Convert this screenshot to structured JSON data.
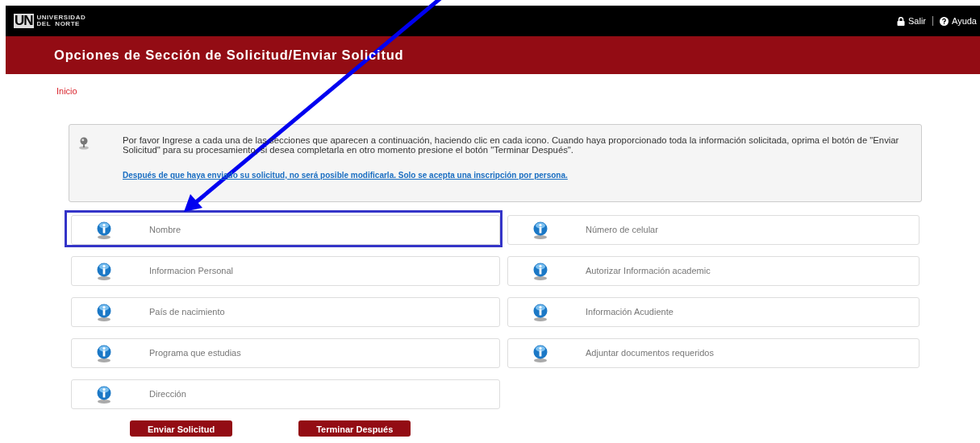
{
  "header": {
    "logo_mark": "UN",
    "logo_lines": [
      "UNIVERSIDAD",
      "DEL  NORTE"
    ],
    "links": [
      {
        "label": "Salir",
        "kind": "lock"
      },
      {
        "label": "Ayuda",
        "kind": "help"
      }
    ]
  },
  "title": "Opciones de Sección de Solicitud/Enviar Solicitud",
  "breadcrumb": "Inicio",
  "notice": {
    "text": "Por favor Ingrese a cada una de las secciones que aparecen a continuación, haciendo clic en cada icono. Cuando haya proporcionado toda la información solicitada, oprima el botón de \"Enviar Solicitud\" para su procesamiento, si desea completarla en otro momento presione el botón \"Terminar Después\".",
    "link": "Después de que haya enviado su solicitud, no será posible modificarla. Solo se acepta una inscripción por persona."
  },
  "sections": [
    [
      {
        "label": "Nombre",
        "highlighted": true
      },
      {
        "label": "Informacion Personal",
        "highlighted": false
      },
      {
        "label": "País de nacimiento",
        "highlighted": false
      },
      {
        "label": "Programa que estudias",
        "highlighted": false
      },
      {
        "label": "Dirección",
        "highlighted": false
      }
    ],
    [
      {
        "label": "Número de celular",
        "highlighted": false
      },
      {
        "label": "Autorizar Información academic",
        "highlighted": false
      },
      {
        "label": "Información Acudiente",
        "highlighted": false
      },
      {
        "label": "Adjuntar documentos requeridos",
        "highlighted": false
      }
    ]
  ],
  "buttons": [
    "Enviar Solicitud",
    "Terminar Después"
  ]
}
